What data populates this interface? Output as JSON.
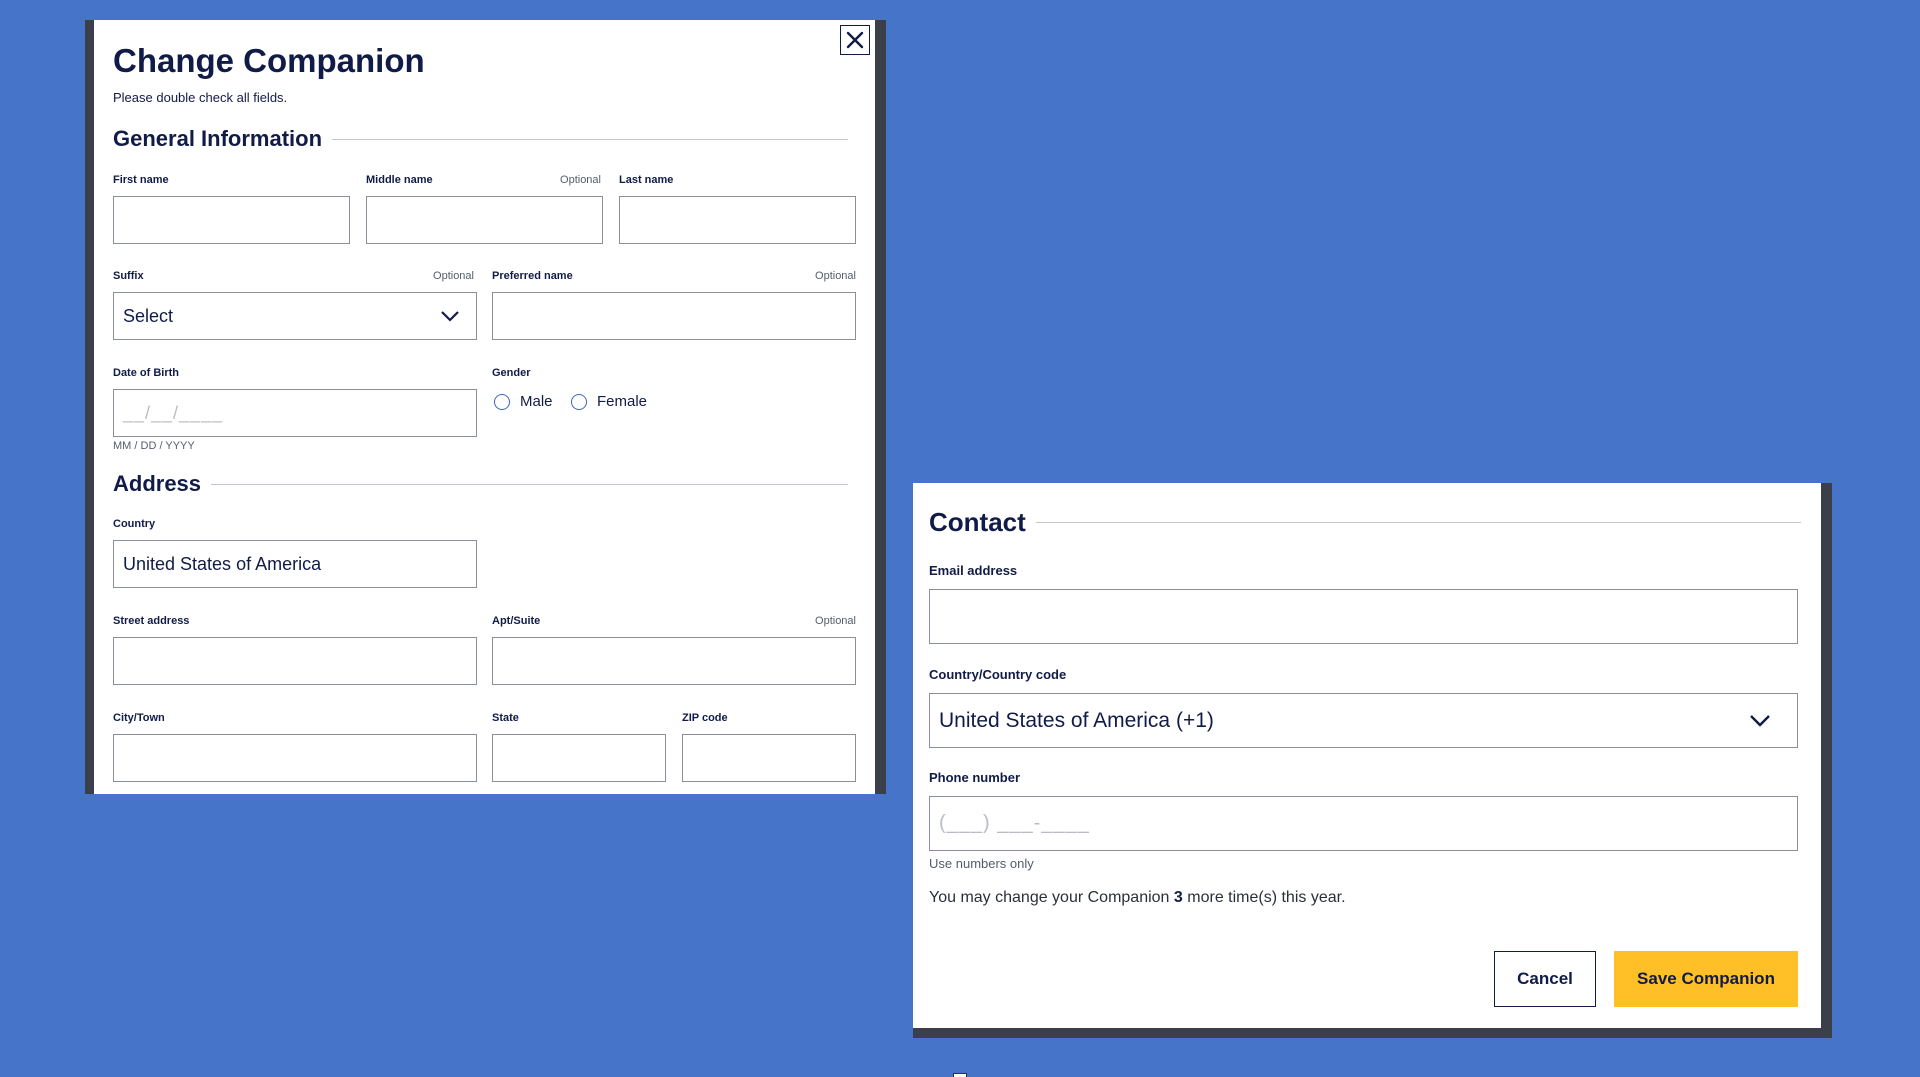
{
  "modal": {
    "title": "Change Companion",
    "subtitle": "Please double check all fields.",
    "close_icon": "close-icon"
  },
  "general": {
    "heading": "General Information",
    "first_name": {
      "label": "First name",
      "value": ""
    },
    "middle_name": {
      "label": "Middle name",
      "optional": "Optional",
      "value": ""
    },
    "last_name": {
      "label": "Last name",
      "value": ""
    },
    "suffix": {
      "label": "Suffix",
      "optional": "Optional",
      "selected": "Select"
    },
    "preferred_name": {
      "label": "Preferred name",
      "optional": "Optional",
      "value": ""
    },
    "dob": {
      "label": "Date of Birth",
      "placeholder": "__/__/____",
      "hint": "MM / DD / YYYY"
    },
    "gender": {
      "label": "Gender",
      "options": [
        "Male",
        "Female"
      ]
    }
  },
  "address": {
    "heading": "Address",
    "country": {
      "label": "Country",
      "value": "United States of America"
    },
    "street": {
      "label": "Street address",
      "value": ""
    },
    "apt": {
      "label": "Apt/Suite",
      "optional": "Optional",
      "value": ""
    },
    "city": {
      "label": "City/Town",
      "value": ""
    },
    "state": {
      "label": "State",
      "value": ""
    },
    "zip": {
      "label": "ZIP code",
      "value": ""
    }
  },
  "contact": {
    "heading": "Contact",
    "email": {
      "label": "Email address",
      "value": ""
    },
    "country_code": {
      "label": "Country/Country code",
      "selected": "United States of America (+1)"
    },
    "phone": {
      "label": "Phone number",
      "placeholder": "(___) ___-____",
      "hint": "Use numbers only"
    },
    "note_before": "You may change your Companion ",
    "note_count": "3",
    "note_after": " more time(s) this year."
  },
  "actions": {
    "cancel_label": "Cancel",
    "save_label": "Save Companion"
  },
  "colors": {
    "background": "#4574c8",
    "navy": "#111b47",
    "save_button": "#ffbf27"
  }
}
